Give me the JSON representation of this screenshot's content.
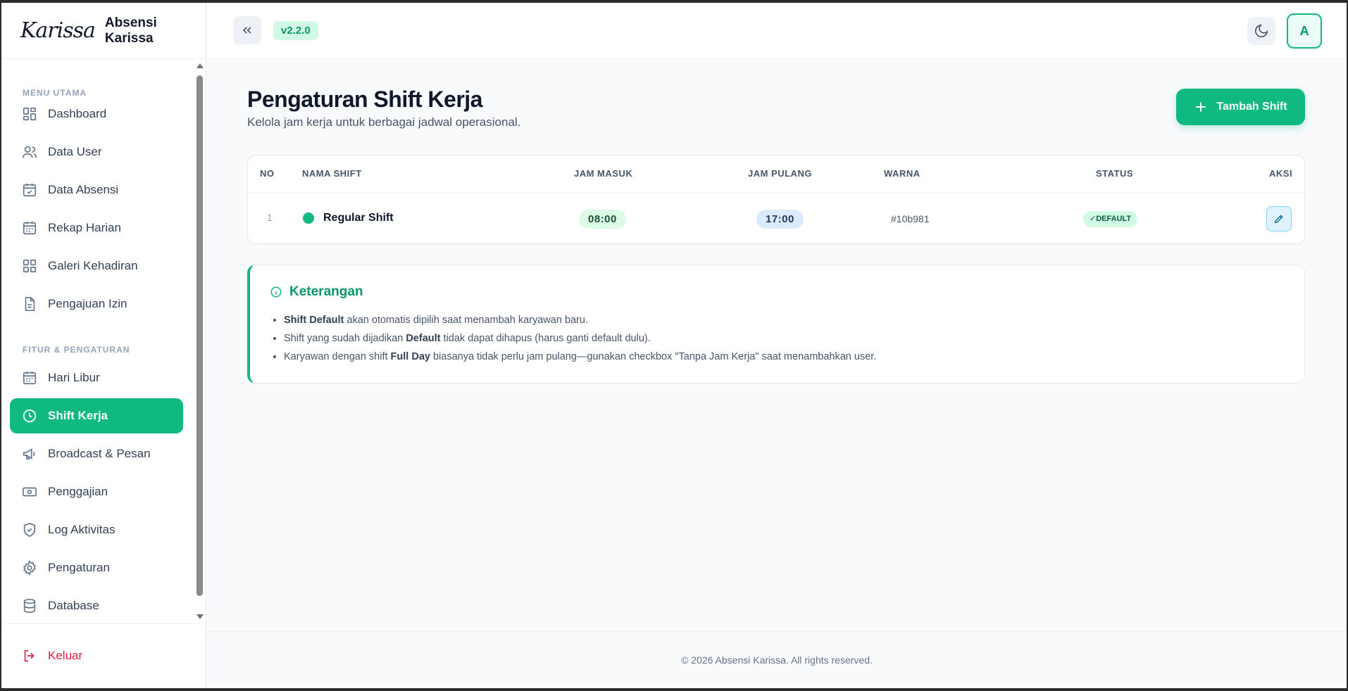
{
  "brand": {
    "logo_text": "Karissa",
    "app_name": "Absensi Karissa"
  },
  "sidebar": {
    "section_main": "MENU UTAMA",
    "section_features": "FITUR & PENGATURAN",
    "items": [
      {
        "label": "Dashboard",
        "icon": "grid-icon"
      },
      {
        "label": "Data User",
        "icon": "users-icon"
      },
      {
        "label": "Data Absensi",
        "icon": "calendar-check-icon"
      },
      {
        "label": "Rekap Harian",
        "icon": "calendar-icon"
      },
      {
        "label": "Galeri Kehadiran",
        "icon": "grid-icon"
      },
      {
        "label": "Pengajuan Izin",
        "icon": "document-icon"
      },
      {
        "label": "Hari Libur",
        "icon": "calendar-icon"
      },
      {
        "label": "Shift Kerja",
        "icon": "clock-icon",
        "active": true
      },
      {
        "label": "Broadcast & Pesan",
        "icon": "megaphone-icon"
      },
      {
        "label": "Penggajian",
        "icon": "banknote-icon"
      },
      {
        "label": "Log Aktivitas",
        "icon": "shield-check-icon"
      },
      {
        "label": "Pengaturan",
        "icon": "gear-icon"
      },
      {
        "label": "Database",
        "icon": "database-icon"
      }
    ],
    "logout_label": "Keluar"
  },
  "topbar": {
    "version": "v2.2.0",
    "avatar_initial": "A"
  },
  "page": {
    "title": "Pengaturan Shift Kerja",
    "subtitle": "Kelola jam kerja untuk berbagai jadwal operasional.",
    "add_button": "Tambah Shift"
  },
  "table": {
    "headers": {
      "no": "NO",
      "name": "NAMA SHIFT",
      "in": "JAM MASUK",
      "out": "JAM PULANG",
      "color": "WARNA",
      "status": "STATUS",
      "action": "AKSI"
    },
    "rows": [
      {
        "no": "1",
        "name": "Regular Shift",
        "jam_masuk": "08:00",
        "jam_pulang": "17:00",
        "warna": "#10b981",
        "status": "✓DEFAULT"
      }
    ]
  },
  "info": {
    "title": "Keterangan",
    "items": [
      {
        "bold": "Shift Default",
        "pre": "",
        "post": " akan otomatis dipilih saat menambah karyawan baru."
      },
      {
        "pre": "Shift yang sudah dijadikan ",
        "bold": "Default",
        "post": " tidak dapat dihapus (harus ganti default dulu)."
      },
      {
        "pre": "Karyawan dengan shift ",
        "bold": "Full Day",
        "post": " biasanya tidak perlu jam pulang—gunakan checkbox \"Tanpa Jam Kerja\" saat menambahkan user."
      }
    ]
  },
  "footer": {
    "text": "© 2026 Absensi Karissa. All rights reserved."
  },
  "colors": {
    "accent": "#10b981",
    "danger": "#e11d48"
  }
}
